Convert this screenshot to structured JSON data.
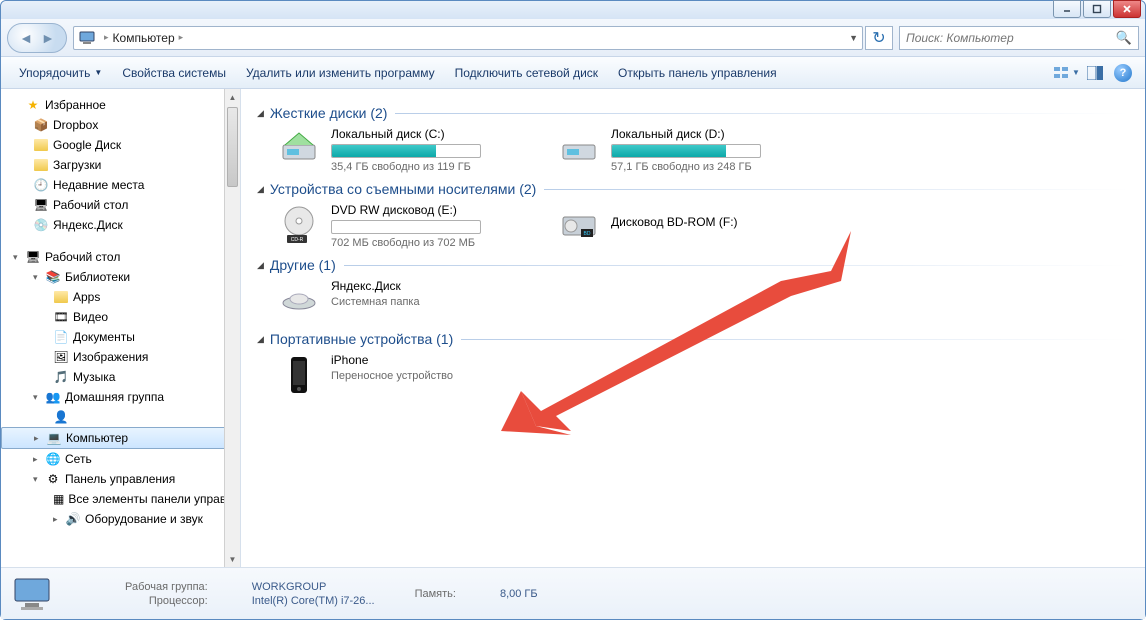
{
  "window": {
    "title": "Компьютер"
  },
  "breadcrumb": {
    "root": "Компьютер"
  },
  "search": {
    "placeholder": "Поиск: Компьютер"
  },
  "toolbar": {
    "organize": "Упорядочить",
    "system_props": "Свойства системы",
    "uninstall": "Удалить или изменить программу",
    "map_drive": "Подключить сетевой диск",
    "control_panel": "Открыть панель управления"
  },
  "sidebar": {
    "favorites": "Избранное",
    "fav_items": [
      {
        "label": "Dropbox"
      },
      {
        "label": "Google Диск"
      },
      {
        "label": "Загрузки"
      },
      {
        "label": "Недавние места"
      },
      {
        "label": "Рабочий стол"
      },
      {
        "label": "Яндекс.Диск"
      }
    ],
    "desktop": "Рабочий стол",
    "libraries": "Библиотеки",
    "lib_items": [
      {
        "label": "Apps"
      },
      {
        "label": "Видео"
      },
      {
        "label": "Документы"
      },
      {
        "label": "Изображения"
      },
      {
        "label": "Музыка"
      }
    ],
    "homegroup": "Домашняя группа",
    "homegroup_user": "",
    "computer": "Компьютер",
    "network": "Сеть",
    "control_panel": "Панель управления",
    "cp_items": [
      {
        "label": "Все элементы панели управле"
      },
      {
        "label": "Оборудование и звук"
      }
    ]
  },
  "sections": {
    "hdd": {
      "title": "Жесткие диски",
      "count": "(2)"
    },
    "removable": {
      "title": "Устройства со съемными носителями",
      "count": "(2)"
    },
    "other": {
      "title": "Другие",
      "count": "(1)"
    },
    "portable": {
      "title": "Портативные устройства",
      "count": "(1)"
    }
  },
  "drives": {
    "c": {
      "name": "Локальный диск (C:)",
      "free": "35,4 ГБ свободно из 119 ГБ",
      "fill_pct": 70
    },
    "d": {
      "name": "Локальный диск (D:)",
      "free": "57,1 ГБ свободно из 248 ГБ",
      "fill_pct": 77
    },
    "e": {
      "name": "DVD RW дисковод (E:)",
      "free": "702 МБ свободно из 702 МБ",
      "fill_pct": 0
    },
    "f": {
      "name": "Дисковод BD-ROM (F:)",
      "free": ""
    },
    "yadisk": {
      "name": "Яндекс.Диск",
      "sub": "Системная папка"
    },
    "iphone": {
      "name": "iPhone",
      "sub": "Переносное устройство"
    }
  },
  "status": {
    "workgroup_label": "Рабочая группа:",
    "workgroup": "WORKGROUP",
    "cpu_label": "Процессор:",
    "cpu": "Intel(R) Core(TM) i7-26...",
    "memory_label": "Память:",
    "memory": "8,00 ГБ"
  }
}
